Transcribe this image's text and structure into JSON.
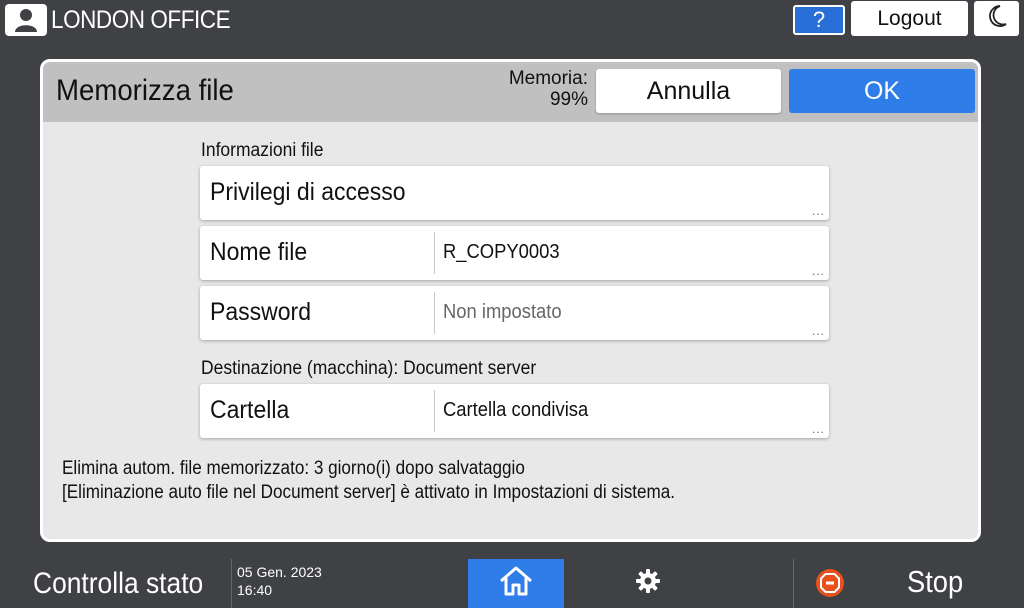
{
  "header": {
    "user_icon": "user-icon",
    "office_name": "LONDON OFFICE",
    "help_label": "?",
    "logout_label": "Logout",
    "energy_icon": "moon-icon"
  },
  "dialog": {
    "title": "Memorizza file",
    "memory_label": "Memoria:",
    "memory_value": "99%",
    "cancel_label": "Annulla",
    "ok_label": "OK",
    "file_info_label": "Informazioni file",
    "fields": [
      {
        "label": "Privilegi di accesso",
        "value": ""
      },
      {
        "label": "Nome file",
        "value": "R_COPY0003"
      },
      {
        "label": "Password",
        "value": "Non impostato"
      }
    ],
    "destination_label": "Destinazione (macchina): Document server",
    "folder_field": {
      "label": "Cartella",
      "value": "Cartella condivisa"
    },
    "ellipsis": "...",
    "note_line1": "Elimina autom. file memorizzato: 3 giorno(i) dopo salvataggio",
    "note_line2": "[Eliminazione auto file nel Document server] è attivato in Impostazioni di sistema."
  },
  "footer": {
    "status_label": "Controlla stato",
    "date": "05 Gen. 2023",
    "time": "16:40",
    "home_icon": "home-icon",
    "settings_icon": "gear-icon",
    "stop_icon": "stop-icon",
    "stop_label": "Stop"
  },
  "colors": {
    "accent_blue": "#2f7de8",
    "bar_gray": "#3f4145",
    "header_gray": "#c0c0c0",
    "panel_gray": "#e8e8e8",
    "stop_orange": "#e8501e"
  }
}
